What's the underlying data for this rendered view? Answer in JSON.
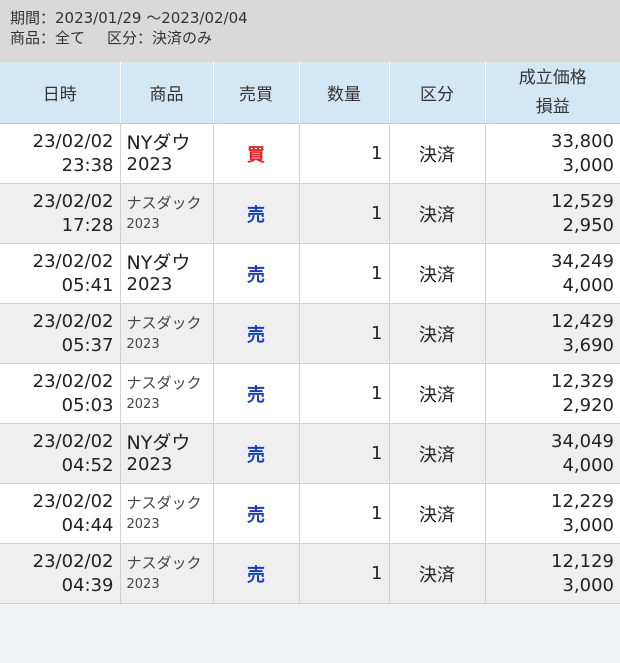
{
  "filter": {
    "period": "期間：2023/01/29 〜2023/02/04",
    "product": "商品：全て",
    "category": "区分：決済のみ"
  },
  "table": {
    "headers": {
      "datetime": "日時",
      "product": "商品",
      "side": "売買",
      "quantity": "数量",
      "type": "区分",
      "price": "成立価格",
      "profit": "損益"
    },
    "rows": [
      {
        "date": "23/02/02",
        "time": "23:38",
        "product": "NYダウ",
        "year": "2023",
        "size": "large",
        "side": "買",
        "side_kind": "buy",
        "quantity": "1",
        "type": "決済",
        "price": "33,800",
        "profit": "3,000"
      },
      {
        "date": "23/02/02",
        "time": "17:28",
        "product": "ナスダック",
        "year": "2023",
        "size": "small",
        "side": "売",
        "side_kind": "sell",
        "quantity": "1",
        "type": "決済",
        "price": "12,529",
        "profit": "2,950"
      },
      {
        "date": "23/02/02",
        "time": "05:41",
        "product": "NYダウ",
        "year": "2023",
        "size": "large",
        "side": "売",
        "side_kind": "sell",
        "quantity": "1",
        "type": "決済",
        "price": "34,249",
        "profit": "4,000"
      },
      {
        "date": "23/02/02",
        "time": "05:37",
        "product": "ナスダック",
        "year": "2023",
        "size": "small",
        "side": "売",
        "side_kind": "sell",
        "quantity": "1",
        "type": "決済",
        "price": "12,429",
        "profit": "3,690"
      },
      {
        "date": "23/02/02",
        "time": "05:03",
        "product": "ナスダック",
        "year": "2023",
        "size": "small",
        "side": "売",
        "side_kind": "sell",
        "quantity": "1",
        "type": "決済",
        "price": "12,329",
        "profit": "2,920"
      },
      {
        "date": "23/02/02",
        "time": "04:52",
        "product": "NYダウ",
        "year": "2023",
        "size": "large",
        "side": "売",
        "side_kind": "sell",
        "quantity": "1",
        "type": "決済",
        "price": "34,049",
        "profit": "4,000"
      },
      {
        "date": "23/02/02",
        "time": "04:44",
        "product": "ナスダック",
        "year": "2023",
        "size": "small",
        "side": "売",
        "side_kind": "sell",
        "quantity": "1",
        "type": "決済",
        "price": "12,229",
        "profit": "3,000"
      },
      {
        "date": "23/02/02",
        "time": "04:39",
        "product": "ナスダック",
        "year": "2023",
        "size": "small",
        "side": "売",
        "side_kind": "sell",
        "quantity": "1",
        "type": "決済",
        "price": "12,129",
        "profit": "3,000"
      }
    ]
  },
  "colors": {
    "buy": "#e02020",
    "sell": "#1a3fb5",
    "header_bg": "#d4e7f5",
    "filter_bg": "#d9d9d9"
  }
}
